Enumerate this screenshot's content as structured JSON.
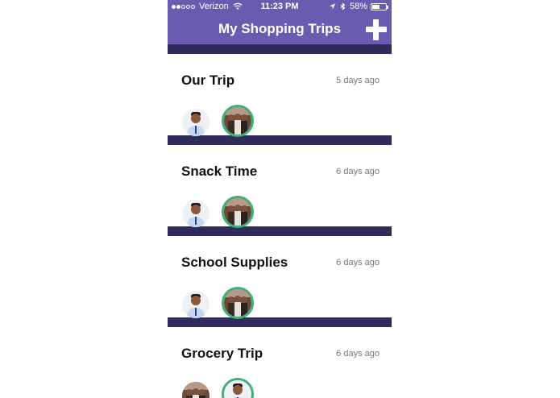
{
  "status_bar": {
    "carrier": "Verizon",
    "time": "11:23 PM",
    "battery": "58%",
    "battery_level": 0.58,
    "signal_bars": 2
  },
  "nav": {
    "title": "My Shopping Trips",
    "add_icon": "plus-icon"
  },
  "colors": {
    "header": "#6b5bb0",
    "separator": "#2f2b5a",
    "avatar_ring": "#3fb07a"
  },
  "trips": [
    {
      "name": "Our Trip",
      "time": "5 days ago"
    },
    {
      "name": "Snack Time",
      "time": "6 days ago"
    },
    {
      "name": "School Supplies",
      "time": "6 days ago"
    },
    {
      "name": "Grocery Trip",
      "time": "6 days ago"
    }
  ]
}
